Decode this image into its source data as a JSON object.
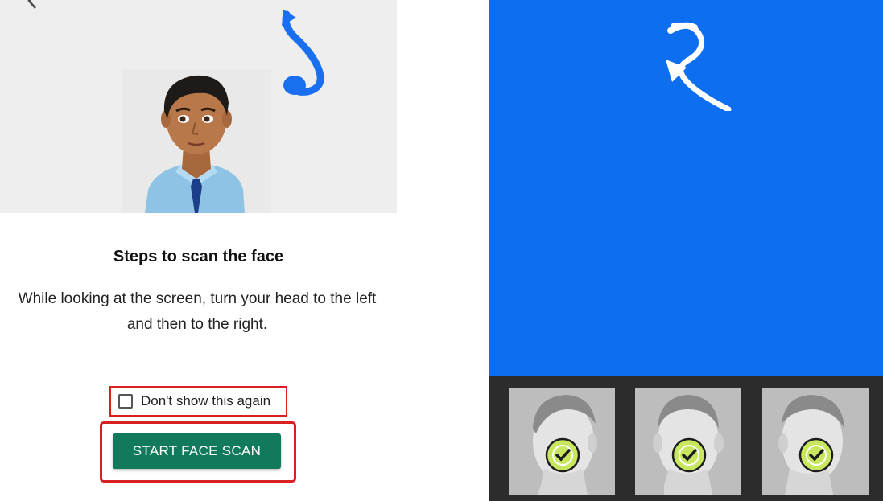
{
  "instructions": {
    "title": "Steps to scan the face",
    "description": "While looking at the screen, turn your head to the left and then to the right.",
    "checkbox_label": "Don't show this again",
    "checkbox_checked": false,
    "start_button_label": "START FACE SCAN"
  },
  "scan_progress": {
    "captures": [
      {
        "icon": "check-icon",
        "status": "captured"
      },
      {
        "icon": "check-icon",
        "status": "captured"
      },
      {
        "icon": "check-icon",
        "status": "captured"
      }
    ]
  },
  "colors": {
    "illustration_bg": "#eeeeee",
    "turn_arrow": "#1a6ff0",
    "button_green": "#117a5c",
    "highlight_red": "#d82020",
    "scan_blue": "#0e6ef0",
    "thumb_strip": "#2c2c2c",
    "check_badge": "#c9e75e"
  }
}
